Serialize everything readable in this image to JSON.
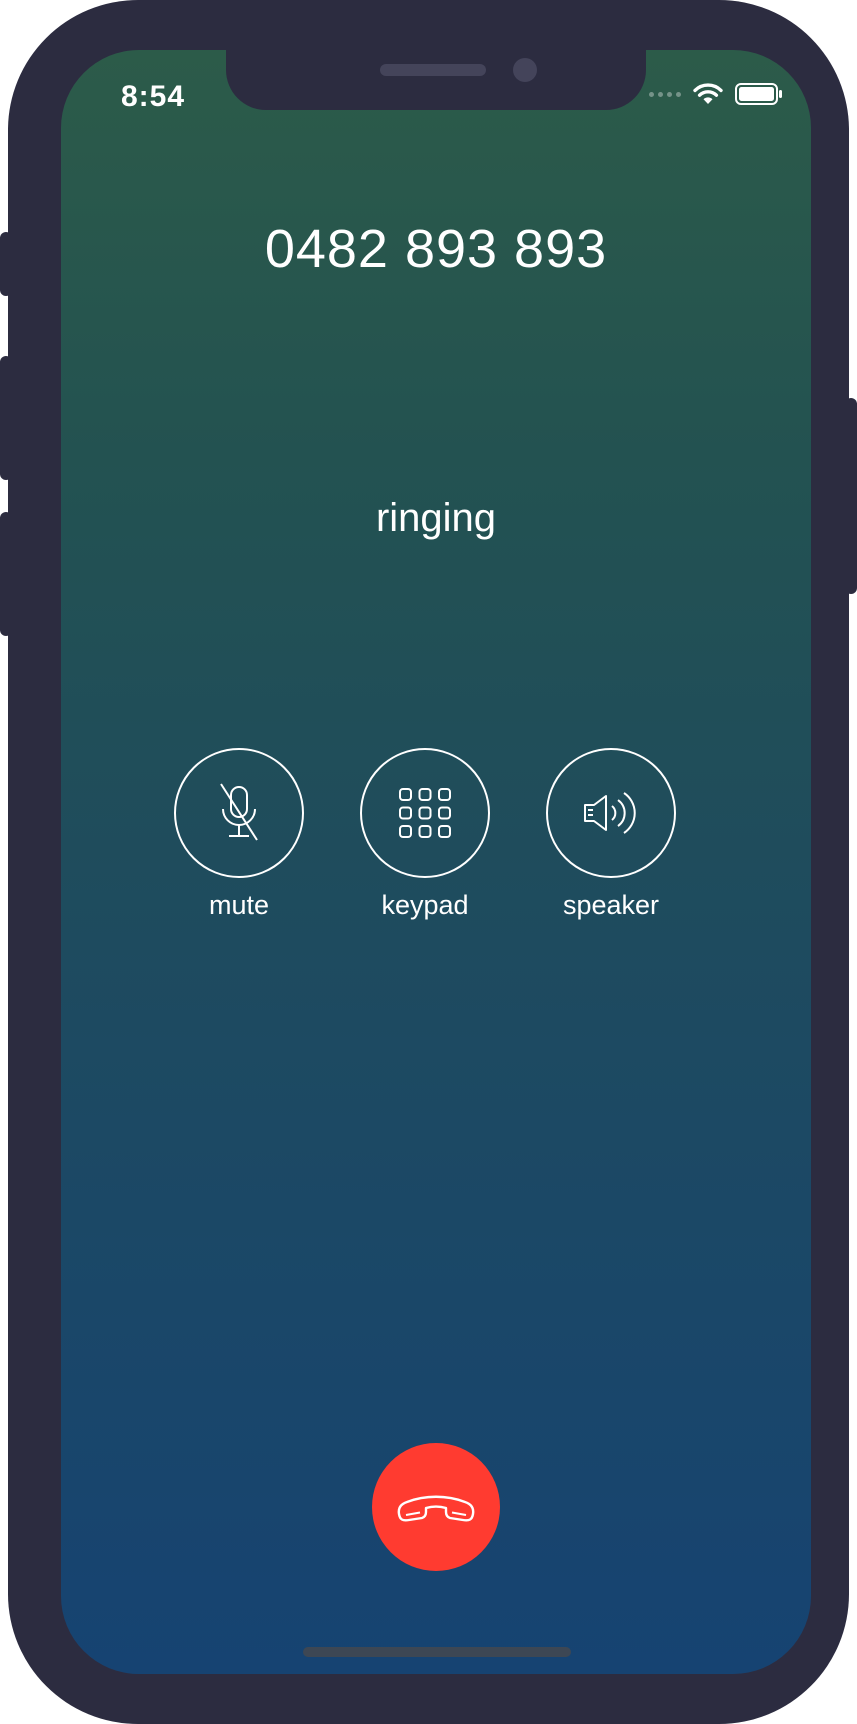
{
  "status_bar": {
    "time": "8:54",
    "icons": [
      "signal-dots-icon",
      "wifi-icon",
      "battery-icon"
    ]
  },
  "call": {
    "number": "0482 893 893",
    "status": "ringing"
  },
  "controls": [
    {
      "id": "mute",
      "label": "mute",
      "icon": "mic-muted-icon"
    },
    {
      "id": "keypad",
      "label": "keypad",
      "icon": "keypad-icon"
    },
    {
      "id": "speaker",
      "label": "speaker",
      "icon": "speaker-icon"
    }
  ],
  "end_call": {
    "icon": "phone-hangup-icon",
    "color": "#ff3b30"
  },
  "colors": {
    "frame": "#2c2c40",
    "gradient_top": "#2c5b49",
    "gradient_bottom": "#164372",
    "end_call_red": "#ff3b30"
  }
}
